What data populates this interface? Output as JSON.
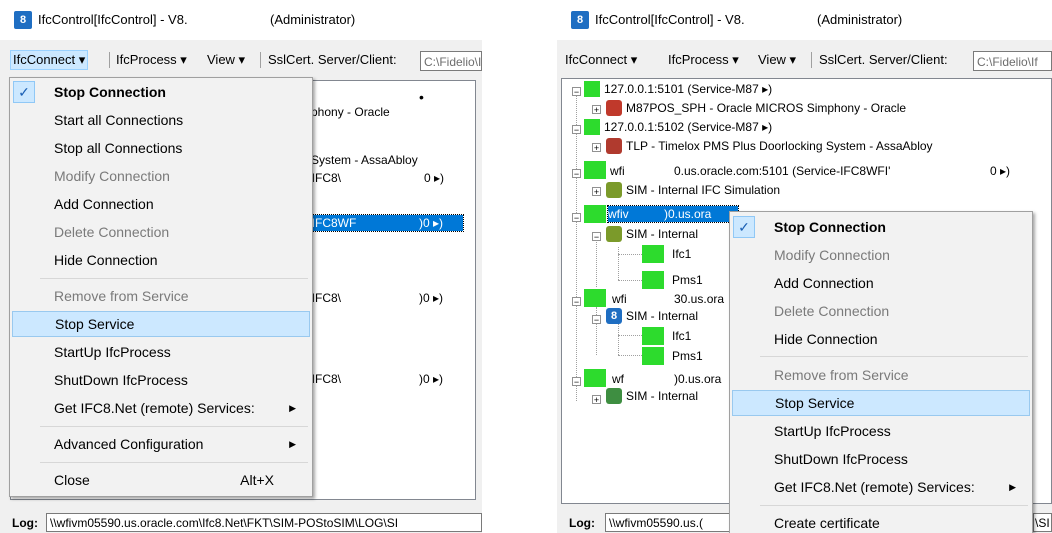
{
  "title": {
    "app_logo": "8",
    "text": "IfcControl[IfcControl] - V8.",
    "admin": "(Administrator)"
  },
  "menubar": {
    "items": [
      "IfcConnect ▾",
      "IfcProcess ▾",
      "View ▾"
    ],
    "ssl_label": "SslCert. Server/Client:",
    "path_left": "C:\\Fidelio\\I",
    "path_right": "C:\\Fidelio\\If"
  },
  "left_tree_fragments": {
    "dot": "•",
    "r1": "mphony - Oracle",
    "r2": "g System - AssaAbloy",
    "r3": "e-IFC8\\",
    "r3s": "0 ▸)",
    "r4": "e-IFC8WF",
    "r4s": ")0 ▸)",
    "r5": "e-IFC8\\",
    "r5s": ")0 ▸)",
    "r6": "e-IFC8\\",
    "r6s": ")0 ▸)"
  },
  "right_tree": {
    "n1": "127.0.0.1:5101 (Service-M87 ▸)",
    "n1c": "M87POS_SPH - Oracle MICROS Simphony - Oracle",
    "n2": "127.0.0.1:5102 (Service-M87 ▸)",
    "n2c": "TLP - Timelox PMS Plus Doorlocking System - AssaAbloy",
    "n3a": "wfi",
    "n3b": "0.us.oracle.com:5101 (Service-IFC8WFI'",
    "n3s": "0 ▸)",
    "n3c": "SIM - Internal IFC Simulation",
    "n4a": "wfiv",
    "n4b": ")0.us.ora",
    "n4c": "SIM - Internal",
    "n4d": "Ifc1",
    "n4e": "Pms1",
    "n5a": "wfi",
    "n5b": "30.us.ora",
    "n5c": "SIM - Internal",
    "n5d": "Ifc1",
    "n5e": "Pms1",
    "n6a": "wf",
    "n6b": ")0.us.ora",
    "n6c": "SIM - Internal"
  },
  "left_menu": {
    "items": [
      "Stop Connection",
      "Start all Connections",
      "Stop all Connections",
      "Modify Connection",
      "Add Connection",
      "Delete Connection",
      "Hide Connection",
      "Remove from Service",
      "Stop Service",
      "StartUp IfcProcess",
      "ShutDown IfcProcess",
      "Get IFC8.Net (remote) Services:",
      "Advanced Configuration",
      "Close"
    ],
    "check": "✓",
    "arrow": "▶",
    "accel_close": "Alt+X"
  },
  "right_menu": {
    "items": [
      "Stop Connection",
      "Modify Connection",
      "Add Connection",
      "Delete Connection",
      "Hide Connection",
      "Remove from Service",
      "Stop Service",
      "StartUp IfcProcess",
      "ShutDown IfcProcess",
      "Get IFC8.Net (remote) Services:",
      "Create certificate"
    ],
    "check": "✓",
    "arrow": "▶"
  },
  "log": {
    "label": "Log:",
    "left": "\\\\wfivm05590.us.oracle.com\\Ifc8.Net\\FKT\\SIM-POStoSIM\\LOG\\SI",
    "right": "\\\\wfivm05590.us.(",
    "right_tail": "\\SI"
  },
  "colors": {
    "status_green": "#2ddb2d",
    "selection": "#0078d7",
    "menu_highlight": "#cce8ff"
  }
}
